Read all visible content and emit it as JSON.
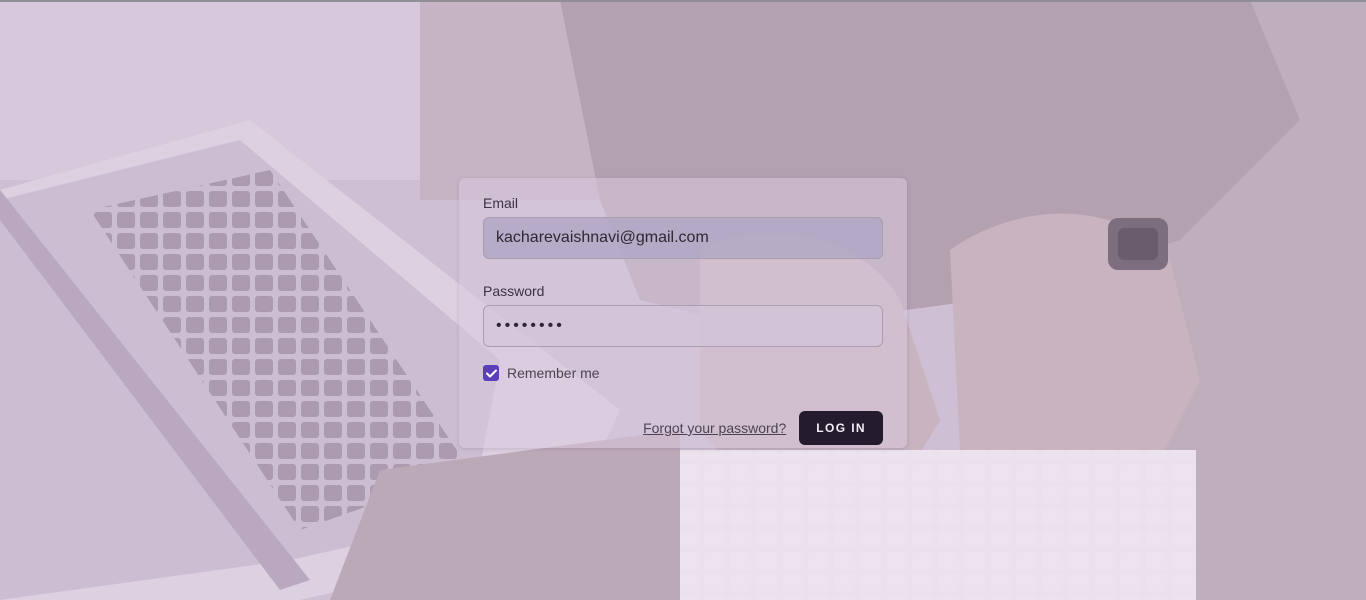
{
  "login_form": {
    "email_label": "Email",
    "email_value": "kacharevaishnavi@gmail.com",
    "password_label": "Password",
    "password_value": "••••••••",
    "remember_label": "Remember me",
    "remember_checked": true,
    "forgot_link": "Forgot your password?",
    "login_button": "LOG IN"
  },
  "icons": {
    "checkbox": "checkmark-icon"
  },
  "colors": {
    "overlay_tint": "#cdbdd3",
    "checkbox_accent": "#5a3fb8",
    "button_background": "#251b2e",
    "button_text": "#f2eef5"
  }
}
